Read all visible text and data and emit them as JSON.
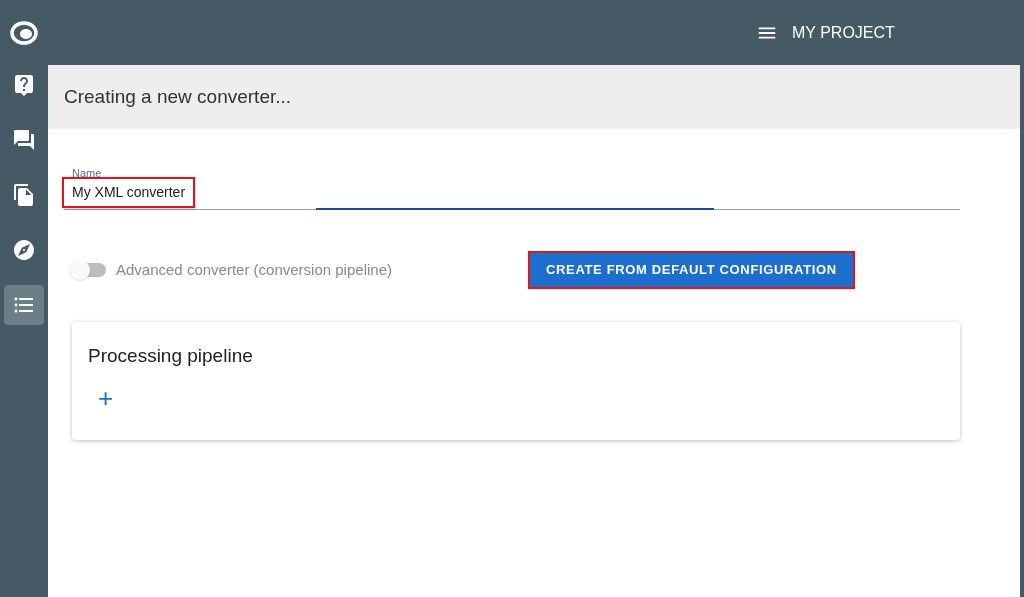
{
  "sidebar": {
    "items": [
      {
        "kind": "help",
        "selected": false
      },
      {
        "kind": "chat",
        "selected": false
      },
      {
        "kind": "documents",
        "selected": false
      },
      {
        "kind": "compass",
        "selected": false
      },
      {
        "kind": "list",
        "selected": true
      }
    ]
  },
  "topbar": {
    "project": "MY PROJECT"
  },
  "page": {
    "title": "Creating a new converter..."
  },
  "form": {
    "name_field": {
      "label": "Name",
      "value": "My XML converter"
    },
    "advanced_toggle": {
      "label": "Advanced converter (conversion pipeline)",
      "on": false
    },
    "create_button": "CREATE FROM DEFAULT CONFIGURATION"
  },
  "pipeline_card": {
    "title": "Processing pipeline",
    "add_button": "+"
  }
}
